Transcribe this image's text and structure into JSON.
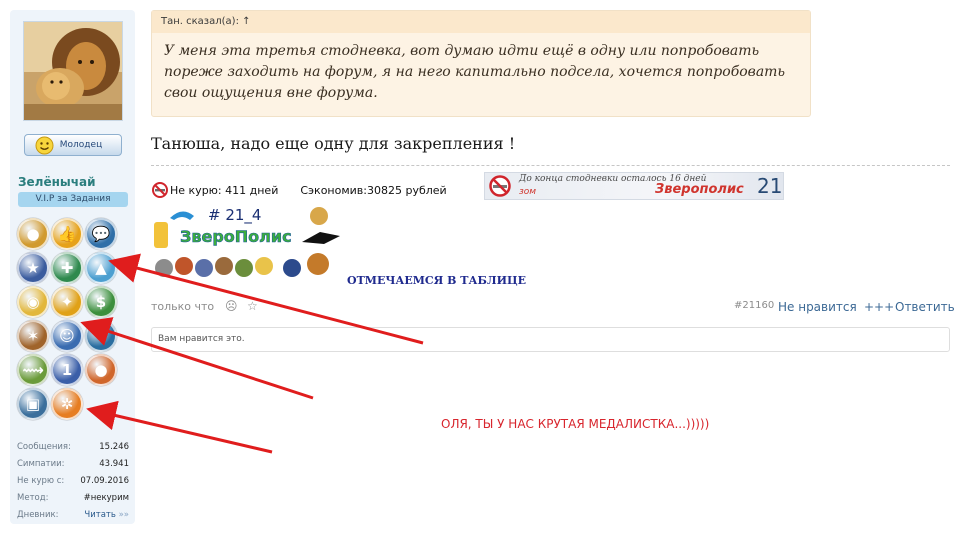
{
  "user": {
    "avatar_alt": "lion avatar",
    "praise_label": "Молодец",
    "username": "Зелёнычай",
    "title": "V.I.P за Задания",
    "stats": [
      {
        "label": "Сообщения:",
        "value": "15.246"
      },
      {
        "label": "Симпатии:",
        "value": "43.941"
      },
      {
        "label": "Не курю с:",
        "value": "07.09.2016"
      },
      {
        "label": "Метод:",
        "value": "#некурим"
      },
      {
        "label": "Дневник:",
        "value": "Читать",
        "more": "»»"
      }
    ],
    "awards": [
      {
        "icon": "person-icon",
        "color": "#d19a2e"
      },
      {
        "icon": "thumbs-up-icon",
        "color": "#e6a21a"
      },
      {
        "icon": "chat-bubble-icon",
        "color": "#2f6fa8"
      },
      {
        "icon": "star-icon",
        "color": "#3b5c9e"
      },
      {
        "icon": "pharmacy-cross-icon",
        "color": "#2f8a4e"
      },
      {
        "icon": "mountain-icon",
        "color": "#4c9fd0"
      },
      {
        "icon": "medal-icon",
        "color": "#e2b73c"
      },
      {
        "icon": "three-stars-icon",
        "color": "#e0a118"
      },
      {
        "icon": "money-bag-icon",
        "color": "#3c8f3c"
      },
      {
        "icon": "stars-icon",
        "color": "#a0642b"
      },
      {
        "icon": "group-icon",
        "color": "#3a6cb0"
      },
      {
        "icon": "airplane-icon",
        "color": "#2a6ea0"
      },
      {
        "icon": "runner-icon",
        "color": "#6b9b3a"
      },
      {
        "icon": "number-one-icon",
        "color": "#3b5fa8"
      },
      {
        "icon": "tomato-icon",
        "color": "#d0662b"
      },
      {
        "icon": "train-icon",
        "color": "#3b6f9c"
      },
      {
        "icon": "people-circle-icon",
        "color": "#e67d22"
      }
    ]
  },
  "post": {
    "quote_header": "Тан. сказал(а): ↑",
    "quote_lines": [
      "У меня эта третья стодневка, вот думаю идти ещё в одну или попробовать",
      "пореже заходить на форум, я на него капитально подсела, хочется попробовать",
      "свои ощущения вне форума."
    ],
    "message": "Танюша, надо еще одну для закрепления !",
    "signature": {
      "no_smoke_text": "Не курю: 411 дней",
      "saved_text": "Сэкономив:30825 рублей",
      "banner_text": "До конца стодневки осталось 16 дней",
      "banner_sub": "зом",
      "banner_brand": "Зверополис",
      "banner_num": "21",
      "logo_tag": "# 21_4",
      "logo_name": "ЗвероПолис",
      "celebrate": "ОТМЕЧАЕМСЯ В ТАБЛИЦЕ"
    },
    "footer": {
      "time": "только что",
      "post_number": "#21160",
      "dislike": "Не нравится",
      "plus": "+++",
      "reply": "Ответить"
    },
    "likes_placeholder": "Вам нравится это.",
    "medal_note": "ОЛЯ, ТЫ У НАС КРУТАЯ МЕДАЛИСТКА...)))))"
  },
  "colors": {
    "arrow": "#e01d1d",
    "accent": "#3c6995"
  }
}
